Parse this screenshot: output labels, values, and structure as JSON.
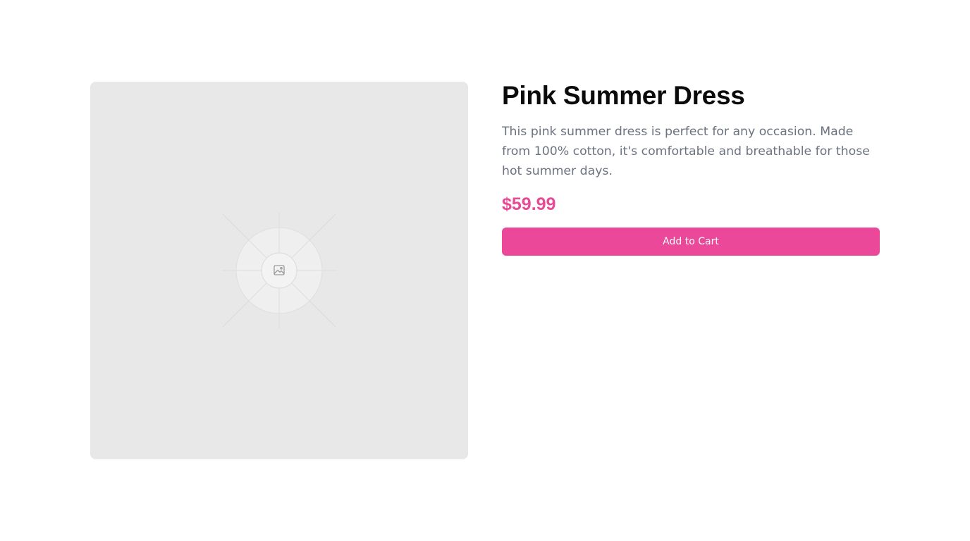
{
  "product": {
    "title": "Pink Summer Dress",
    "description": "This pink summer dress is perfect for any occasion. Made from 100% cotton, it's comfortable and breathable for those hot summer days.",
    "price": "$59.99",
    "add_to_cart_label": "Add to Cart",
    "image_placeholder_icon": "image-icon"
  },
  "colors": {
    "accent": "#ec4899",
    "price": "#e84a96",
    "placeholder_bg": "#e8e8e8",
    "text_muted": "#6b7280",
    "title": "#0b0b0b"
  }
}
